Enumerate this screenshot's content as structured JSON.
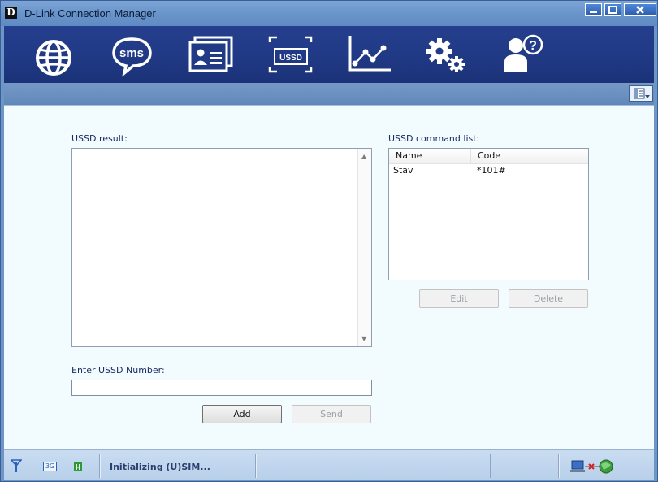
{
  "window": {
    "logo_letter": "D",
    "title": "D-Link Connection Manager"
  },
  "toolbar": {
    "items": [
      {
        "name": "internet",
        "icon": "globe-icon"
      },
      {
        "name": "sms",
        "icon": "sms-bubble-icon",
        "text": "sms"
      },
      {
        "name": "contacts",
        "icon": "contact-card-icon"
      },
      {
        "name": "ussd",
        "icon": "ussd-icon",
        "text": "USSD"
      },
      {
        "name": "statistics",
        "icon": "chart-icon"
      },
      {
        "name": "settings",
        "icon": "gears-icon"
      },
      {
        "name": "help",
        "icon": "user-help-icon",
        "text": "?"
      }
    ]
  },
  "ussd": {
    "result_label": "USSD result:",
    "result_text": "",
    "enter_label": "Enter USSD Number:",
    "number_value": "",
    "add_label": "Add",
    "send_label": "Send",
    "command_list_label": "USSD command list:",
    "columns": [
      "Name",
      "Code"
    ],
    "commands": [
      {
        "name": "Stav",
        "code": "*101#"
      }
    ],
    "edit_label": "Edit",
    "delete_label": "Delete"
  },
  "statusbar": {
    "network_type": "3G",
    "status_text": "Initializing (U)SIM..."
  },
  "colors": {
    "toolbar_bg": "#213a86",
    "content_bg": "#f2fbfe",
    "statusbar_bg": "#c9dcf1",
    "title_bar": "#6b96cc"
  }
}
